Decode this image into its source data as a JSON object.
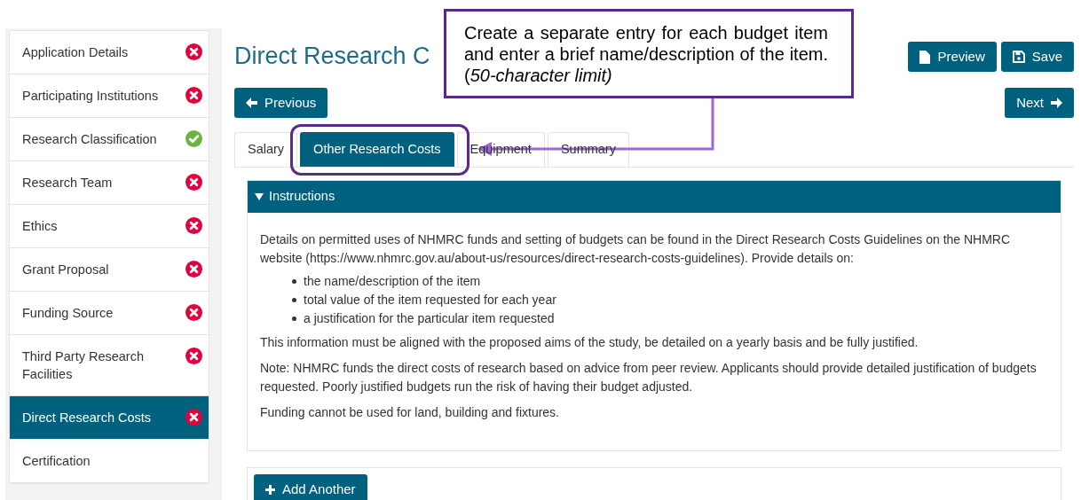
{
  "sidebar": {
    "items": [
      {
        "label": "Application Details",
        "kind": "error",
        "selected": false
      },
      {
        "label": "Participating Institutions",
        "kind": "error",
        "selected": false
      },
      {
        "label": "Research Classification",
        "kind": "done",
        "selected": false
      },
      {
        "label": "Research Team",
        "kind": "error",
        "selected": false
      },
      {
        "label": "Ethics",
        "kind": "error",
        "selected": false
      },
      {
        "label": "Grant Proposal",
        "kind": "error",
        "selected": false
      },
      {
        "label": "Funding Source",
        "kind": "error",
        "selected": false
      },
      {
        "label": "Third Party Research Facilities",
        "kind": "error",
        "selected": false
      },
      {
        "label": "Direct Research Costs",
        "kind": "error",
        "selected": true
      },
      {
        "label": "Certification",
        "kind": "plain",
        "selected": false
      }
    ]
  },
  "header": {
    "title": "Direct Research C",
    "buttons": [
      {
        "label": "Preview",
        "kind": "preview"
      },
      {
        "label": "Save",
        "kind": "save"
      }
    ]
  },
  "nav": {
    "previous": "Previous",
    "next": "Next"
  },
  "tabs": [
    {
      "label": "Salary",
      "selected": false
    },
    {
      "label": "Other Research Costs",
      "selected": true
    },
    {
      "label": "Equipment",
      "selected": false
    },
    {
      "label": "Summary",
      "selected": false
    }
  ],
  "instructions": {
    "title": "Instructions",
    "expanded": true,
    "intro": "Details on permitted uses of NHMRC funds and setting of budgets can be found in the Direct Research Costs Guidelines on the NHMRC website (https://www.nhmrc.gov.au/about-us/resources/direct-research-costs-guidelines). Provide details on:",
    "bullets": [
      "the name/description of the item",
      "total value of the item requested for each year",
      "a justification for the particular item requested"
    ],
    "paragraphs": [
      "This information must be aligned with the proposed aims of the study, be detailed on a yearly basis and be fully justified.",
      "Note: NHMRC funds the direct costs of research based on advice from peer review. Applicants should provide detailed justification of budgets requested. Poorly justified budgets run the risk of having their budget adjusted.",
      "Funding cannot be used for land, building and fixtures."
    ]
  },
  "add_button": "Add Another",
  "callout": {
    "text": "Create a separate entry for each budget item and enter a brief name/description of the item. (*50-character limit)*"
  }
}
